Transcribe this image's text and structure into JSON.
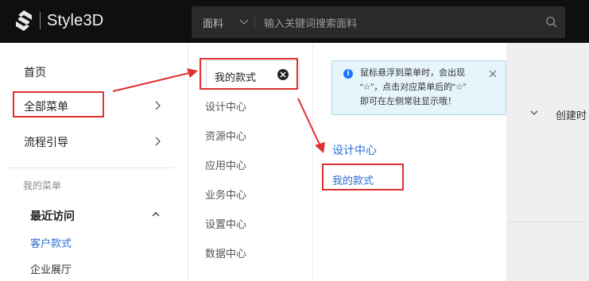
{
  "header": {
    "brand": "Style3D",
    "search": {
      "category": "面料",
      "placeholder": "输入关键词搜索面料"
    }
  },
  "background": {
    "create_label": "创建时"
  },
  "menu_level1": {
    "items": [
      {
        "label": "首页"
      },
      {
        "label": "全部菜单"
      },
      {
        "label": "流程引导"
      }
    ],
    "section_label": "我的菜单",
    "recent_label": "最近访问",
    "recent_items": [
      {
        "label": "客户款式"
      },
      {
        "label": "企业展厅"
      }
    ]
  },
  "menu_level2": {
    "search_value": "我的款式",
    "items": [
      {
        "label": "设计中心"
      },
      {
        "label": "资源中心"
      },
      {
        "label": "应用中心"
      },
      {
        "label": "业务中心"
      },
      {
        "label": "设置中心"
      },
      {
        "label": "数据中心"
      }
    ]
  },
  "menu_level3": {
    "tip_lines": [
      "鼠标悬浮到菜单时，会出现",
      "“☆”，点击对应菜单后的“☆”",
      "即可在左侧常驻显示哦！"
    ],
    "group_title": "设计中心",
    "item_label": "我的款式"
  },
  "colors": {
    "topbar": "#0f0f0f",
    "link_blue": "#2a6ed4",
    "annotation_red": "#e03030",
    "info_bg": "#e6f4fb"
  }
}
